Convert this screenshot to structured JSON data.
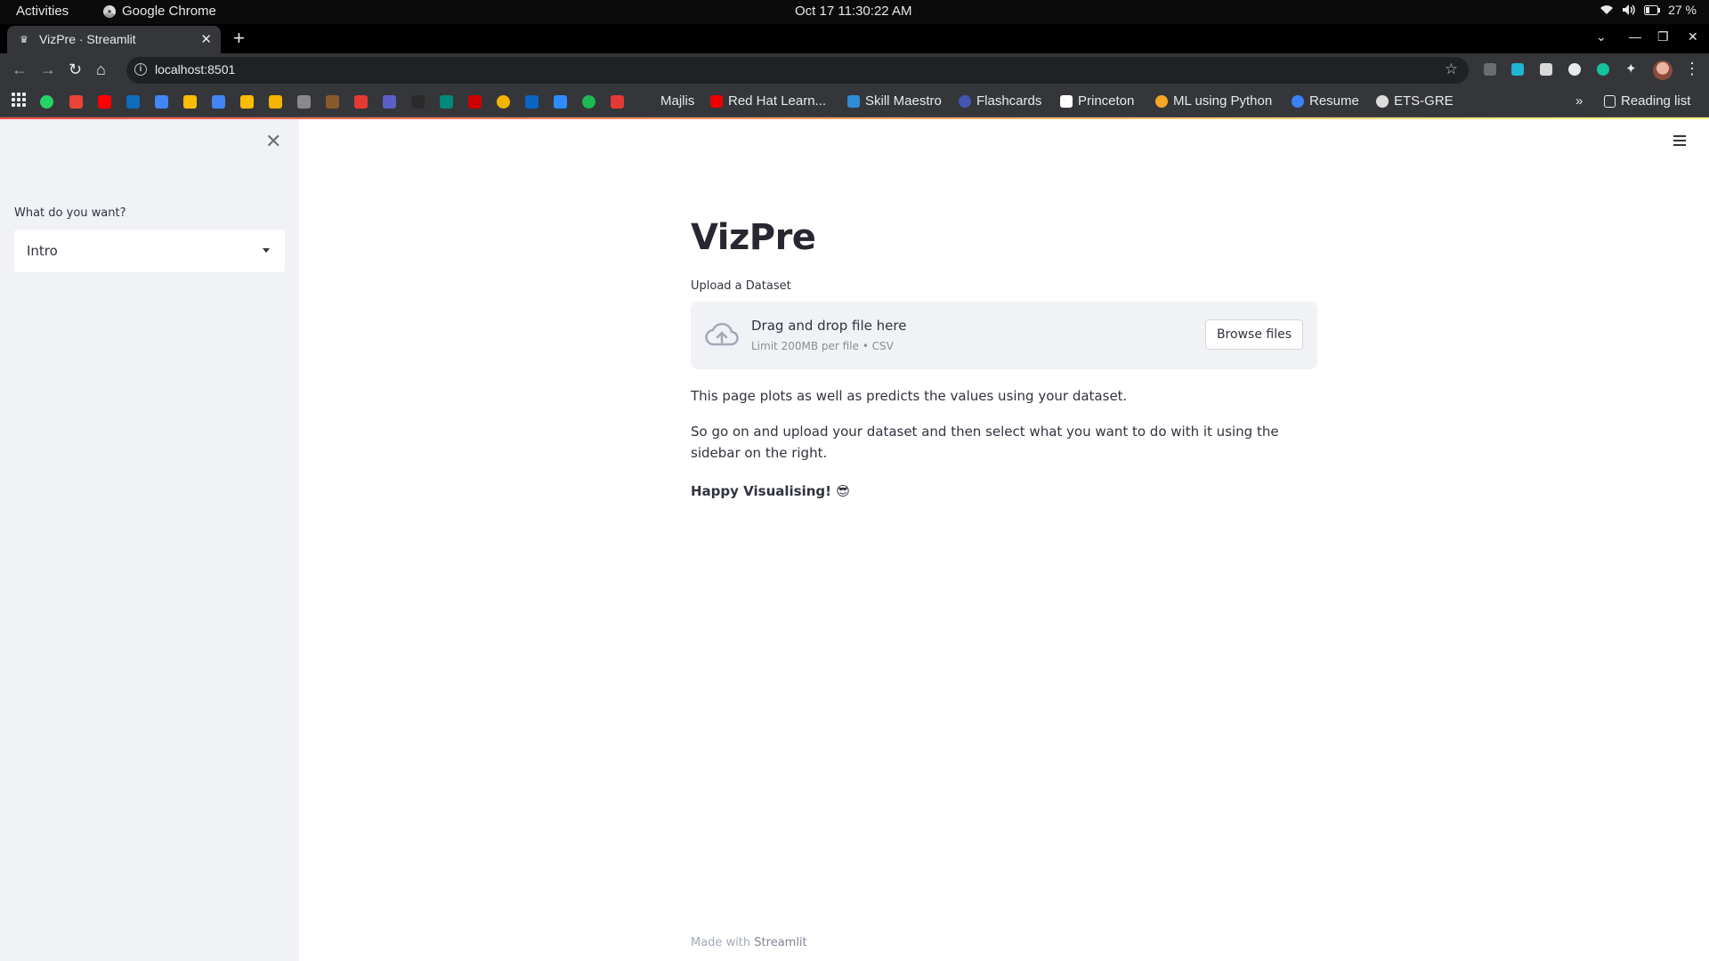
{
  "os_bar": {
    "activities": "Activities",
    "app_name": "Google Chrome",
    "clock": "Oct 17  11:30:22 AM",
    "battery": "27 %"
  },
  "browser": {
    "tab_title": "VizPre · Streamlit",
    "url": "localhost:8501",
    "bookmarks": [
      {
        "label": "Majlis",
        "icon": "bookmark-icon",
        "color": "#cfcfcf"
      },
      {
        "label": "Red Hat Learn...",
        "icon": "redhat-icon",
        "color": "#ee0000"
      },
      {
        "label": "Skill Maestro",
        "icon": "skill-maestro-icon",
        "color": "#2e8bd6"
      },
      {
        "label": "Flashcards",
        "icon": "quizlet-icon",
        "color": "#4257b2"
      },
      {
        "label": "Princeton",
        "icon": "princeton-icon",
        "color": "#ffffff"
      },
      {
        "label": "ML using Python",
        "icon": "coursera-icon",
        "color": "#f5a623"
      },
      {
        "label": "Resume",
        "icon": "resume-icon",
        "color": "#3b82f6"
      },
      {
        "label": "ETS-GRE",
        "icon": "globe-icon",
        "color": "#dddddd"
      }
    ],
    "reading_list": "Reading list"
  },
  "sidebar": {
    "label": "What do you want?",
    "selected": "Intro"
  },
  "main": {
    "title": "VizPre",
    "upload_label": "Upload a Dataset",
    "dropzone_text": "Drag and drop file here",
    "dropzone_limit": "Limit 200MB per file • CSV",
    "browse_button": "Browse files",
    "para1": "This page plots as well as predicts the values using your dataset.",
    "para2": "So go on and upload your dataset and then select what you want to do with it using the sidebar on the right.",
    "para3": "Happy Visualising! 😎"
  },
  "footer": {
    "prefix": "Made with",
    "brand": "Streamlit"
  },
  "colors": {
    "accent_red": "#ff4b4b",
    "sidebar_bg": "#f0f2f6",
    "text": "#31333f"
  }
}
